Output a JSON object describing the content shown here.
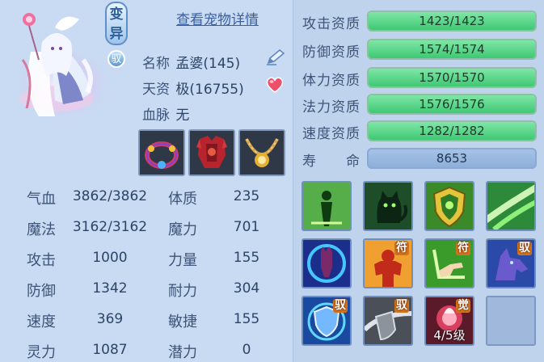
{
  "pet": {
    "tag_bian": "变\n异",
    "tag_yu": "驭",
    "detail_link": "查看宠物详情",
    "name_label": "名称",
    "name_value": "孟婆(145)",
    "talent_label": "天资",
    "talent_value": "极(16755)",
    "blood_label": "血脉",
    "blood_value": "无"
  },
  "stats": {
    "hp_label": "气血",
    "hp_value": "3862/3862",
    "tizhi_label": "体质",
    "tizhi_value": "235",
    "mp_label": "魔法",
    "mp_value": "3162/3162",
    "moli_label": "魔力",
    "moli_value": "701",
    "atk_label": "攻击",
    "atk_value": "1000",
    "liliang_label": "力量",
    "liliang_value": "155",
    "def_label": "防御",
    "def_value": "1342",
    "naili_label": "耐力",
    "naili_value": "304",
    "spd_label": "速度",
    "spd_value": "369",
    "minjie_label": "敏捷",
    "minjie_value": "155",
    "lingli_label": "灵力",
    "lingli_value": "1087",
    "qianli_label": "潜力",
    "qianli_value": "0"
  },
  "aptitude": {
    "attack": {
      "label": "攻击资质",
      "text": "1423/1423",
      "fill": 1.0
    },
    "defense": {
      "label": "防御资质",
      "text": "1574/1574",
      "fill": 1.0
    },
    "physique": {
      "label": "体力资质",
      "text": "1570/1570",
      "fill": 1.0
    },
    "magic": {
      "label": "法力资质",
      "text": "1576/1576",
      "fill": 1.0
    },
    "speed": {
      "label": "速度资质",
      "text": "1282/1282",
      "fill": 1.0
    },
    "life_label": "寿　　命",
    "life_value": "8653"
  },
  "skills": {
    "badge_fu": "符",
    "badge_yu": "驭",
    "badge_jue": "觉",
    "awaken_level": "4/5级"
  },
  "colors": {
    "bar_fill": "#3fc874",
    "panel_bg": "#c8dbf2",
    "text": "#3d5478"
  },
  "icons": [
    "edit-pen-icon",
    "heart-icon",
    "bracelet-icon",
    "armor-icon",
    "necklace-icon"
  ]
}
